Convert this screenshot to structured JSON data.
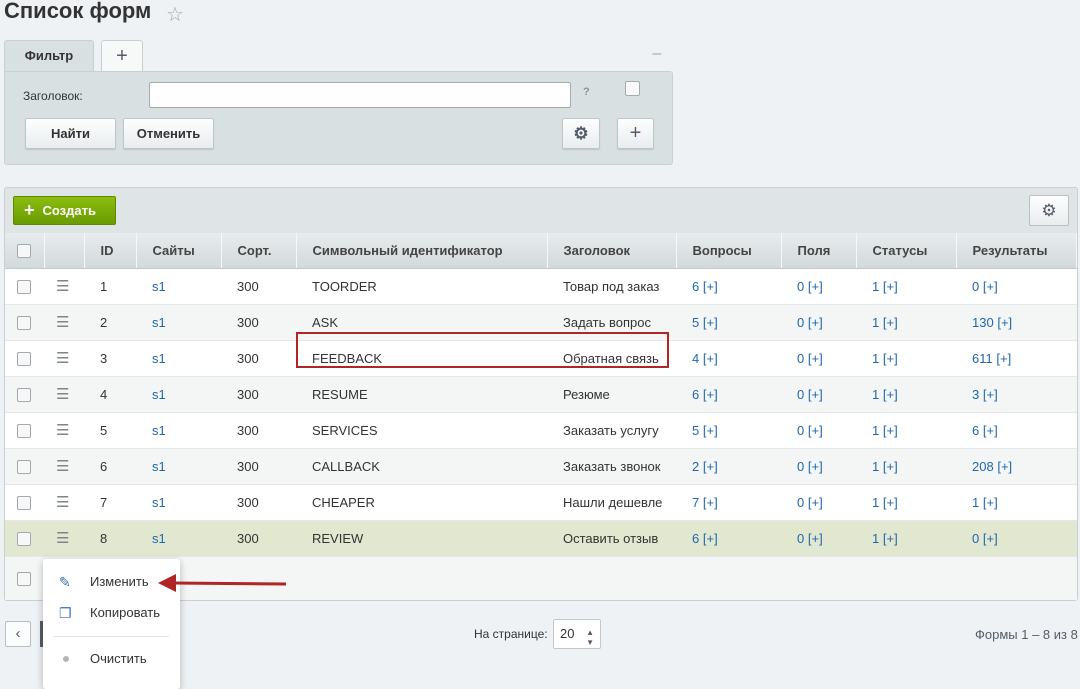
{
  "page": {
    "title": "Список форм"
  },
  "filter": {
    "tab_label": "Фильтр",
    "add_tab_glyph": "+",
    "collapse_glyph": "–",
    "field_label": "Заголовок:",
    "field_value": "",
    "help_glyph": "?",
    "find_label": "Найти",
    "cancel_label": "Отменить"
  },
  "list": {
    "create_label": "Создать",
    "columns": [
      "ID",
      "Сайты",
      "Сорт.",
      "Символьный идентификатор",
      "Заголовок",
      "Вопросы",
      "Поля",
      "Статусы",
      "Результаты"
    ],
    "rows": [
      {
        "id": "1",
        "site": "s1",
        "sort": "300",
        "code": "TOORDER",
        "title": "Товар под заказ",
        "questions": "6",
        "fields": "0",
        "statuses": "1",
        "results": "0"
      },
      {
        "id": "2",
        "site": "s1",
        "sort": "300",
        "code": "ASK",
        "title": "Задать вопрос",
        "questions": "5",
        "fields": "0",
        "statuses": "1",
        "results": "130"
      },
      {
        "id": "3",
        "site": "s1",
        "sort": "300",
        "code": "FEEDBACK",
        "title": "Обратная связь",
        "questions": "4",
        "fields": "0",
        "statuses": "1",
        "results": "611"
      },
      {
        "id": "4",
        "site": "s1",
        "sort": "300",
        "code": "RESUME",
        "title": "Резюме",
        "questions": "6",
        "fields": "0",
        "statuses": "1",
        "results": "3"
      },
      {
        "id": "5",
        "site": "s1",
        "sort": "300",
        "code": "SERVICES",
        "title": "Заказать услугу",
        "questions": "5",
        "fields": "0",
        "statuses": "1",
        "results": "6"
      },
      {
        "id": "6",
        "site": "s1",
        "sort": "300",
        "code": "CALLBACK",
        "title": "Заказать звонок",
        "questions": "2",
        "fields": "0",
        "statuses": "1",
        "results": "208"
      },
      {
        "id": "7",
        "site": "s1",
        "sort": "300",
        "code": "CHEAPER",
        "title": "Нашли дешевле",
        "questions": "7",
        "fields": "0",
        "statuses": "1",
        "results": "1"
      },
      {
        "id": "8",
        "site": "s1",
        "sort": "300",
        "code": "REVIEW",
        "title": "Оставить отзыв",
        "questions": "6",
        "fields": "0",
        "statuses": "1",
        "results": "0"
      }
    ],
    "add_suffix": "[+]"
  },
  "context_menu": {
    "items": [
      "Изменить",
      "Копировать",
      "Очистить"
    ]
  },
  "pagination": {
    "per_page_label": "На странице:",
    "per_page_value": "20",
    "counter": "Формы 1 – 8 из 8"
  },
  "colors": {
    "create_button": "#7bb300",
    "highlight_border": "#b02525",
    "link": "#2067b0",
    "selected_row": "#e2e8d0"
  }
}
